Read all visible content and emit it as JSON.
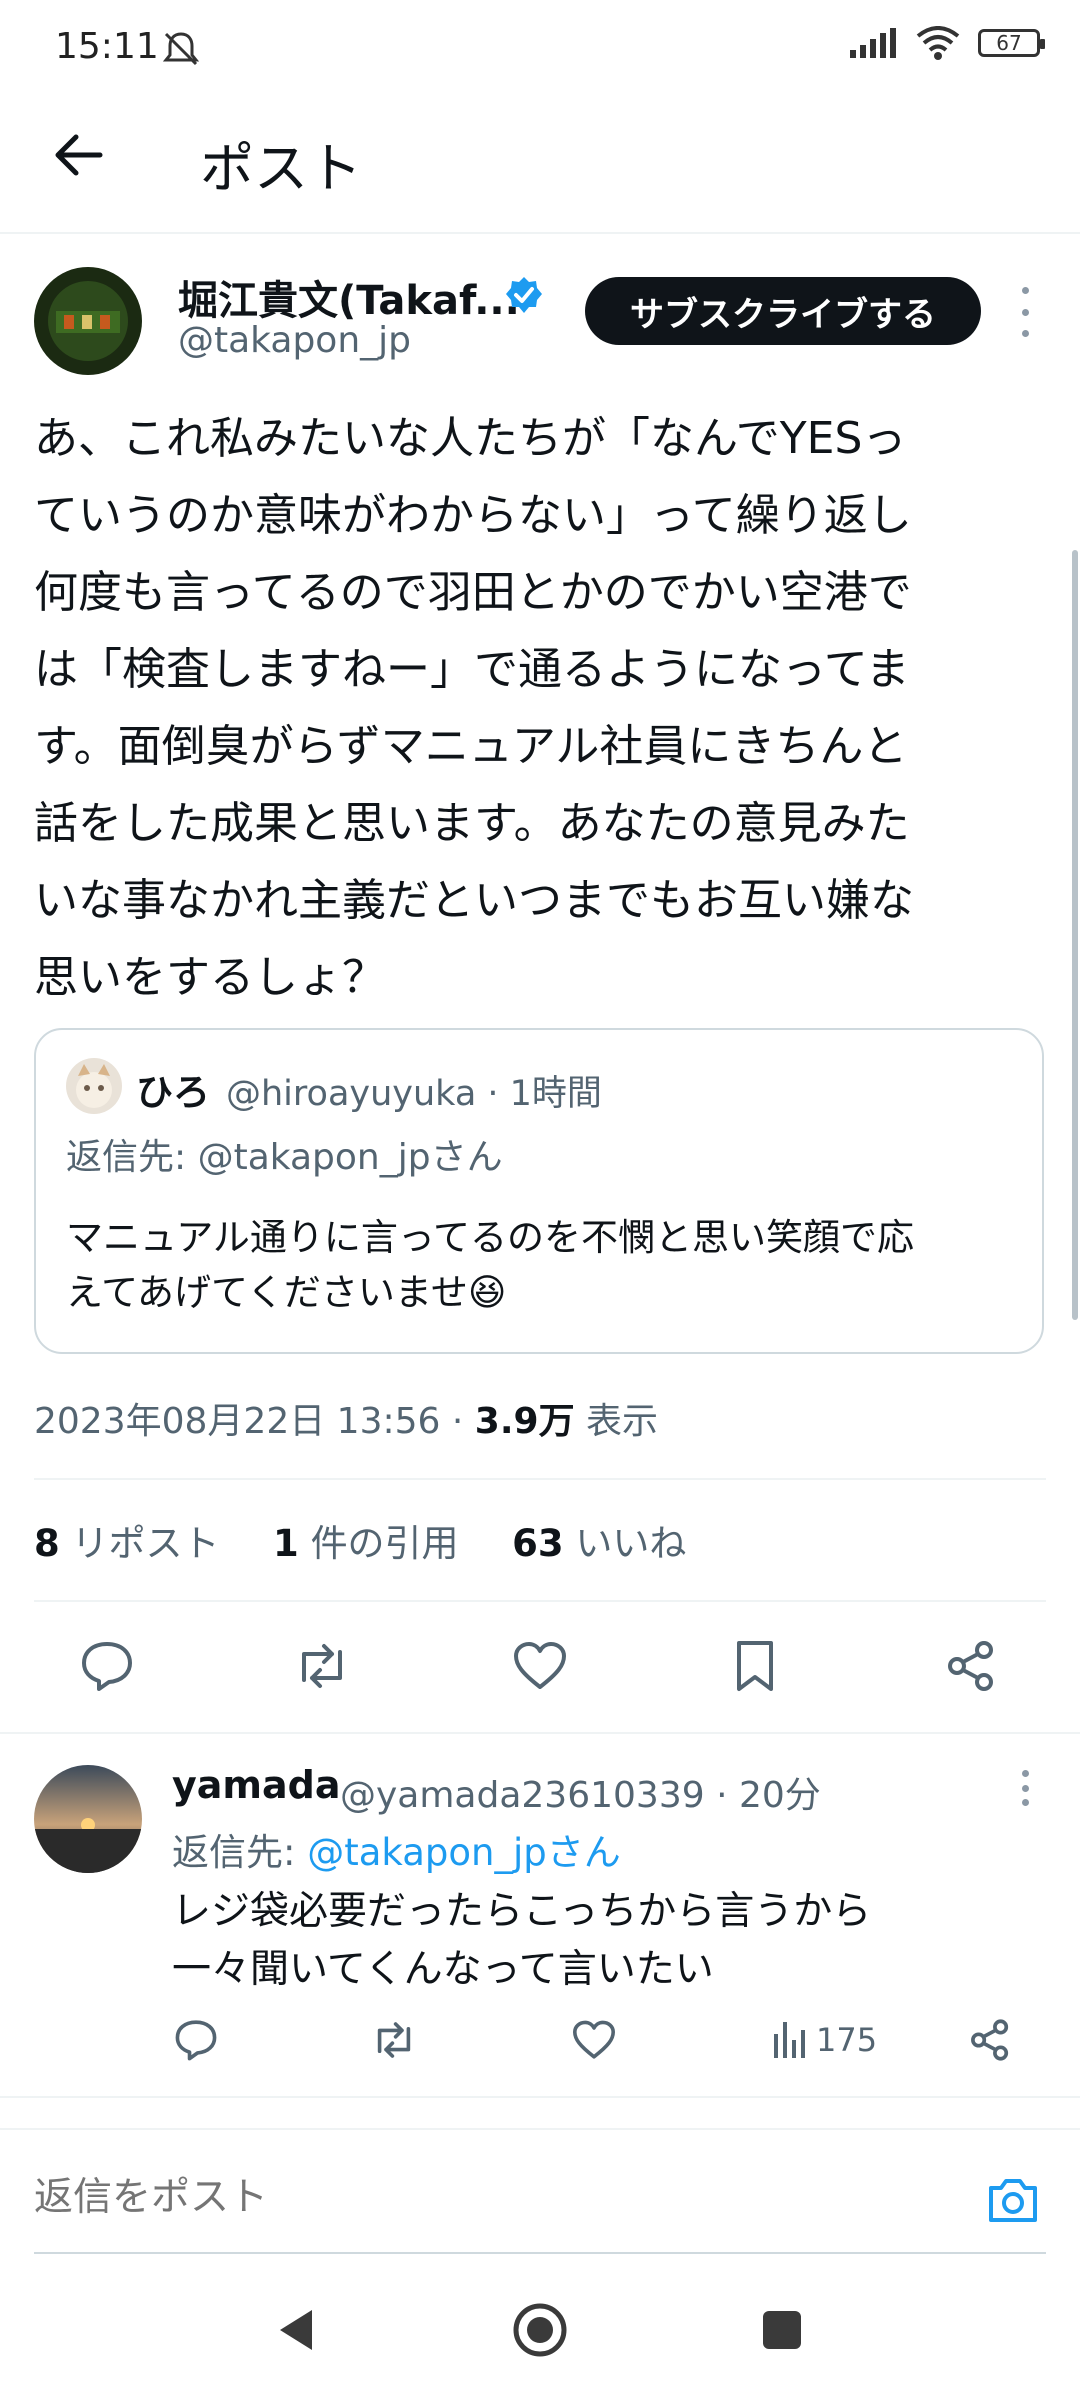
{
  "status_bar": {
    "time": "15:11",
    "battery": "67"
  },
  "header": {
    "title": "ポスト"
  },
  "tweet": {
    "author_name": "堀江貴文(Takaf...",
    "author_handle": "@takapon_jp",
    "subscribe_label": "サブスクライブする",
    "text": "あ、これ私みたいな人たちが「なんでYESっ\nていうのか意味がわからない」って繰り返し\n何度も言ってるので羽田とかのでかい空港で\nは「検査しますねー」で通るようになってま\nす。面倒臭がらずマニュアル社員にきちんと\n話をした成果と思います。あなたの意見みた\nいな事なかれ主義だといつまでもお互い嫌な\n思いをするしょ？",
    "quote": {
      "name": "ひろ",
      "handle_time": "@hiroayuyuka · 1時間",
      "reply_to": "返信先: @takapon_jpさん",
      "text": "マニュアル通りに言ってるのを不憫と思い笑顔で応\nえてあげてくださいませ😆"
    },
    "date": "2023年08月22日 13:56",
    "dot": "·",
    "views_count": "3.9万",
    "views_label": "表示",
    "stats": {
      "reposts_count": "8",
      "reposts_label": "リポスト",
      "quotes_count": "1",
      "quotes_label": "件の引用",
      "likes_count": "63",
      "likes_label": "いいね"
    }
  },
  "reply": {
    "name": "yamada",
    "handle_time": "@yamada23610339 · 20分",
    "reply_to_prefix": "返信先: ",
    "reply_to_link": "@takapon_jpさん",
    "text": "レジ袋必要だったらこっちから言うから\n一々聞いてくんなって言いたい",
    "views": "175"
  },
  "reply_box": {
    "placeholder": "返信をポスト"
  },
  "colors": {
    "accent": "#1d9bf0",
    "text": "#0f1419",
    "muted": "#536471",
    "border": "#cfd9de"
  },
  "icons": [
    "back-arrow-icon",
    "verified-badge-icon",
    "more-icon",
    "reply-icon",
    "repost-icon",
    "like-icon",
    "bookmark-icon",
    "share-icon",
    "views-icon",
    "camera-icon",
    "nav-back-icon",
    "nav-home-icon",
    "nav-recents-icon"
  ]
}
